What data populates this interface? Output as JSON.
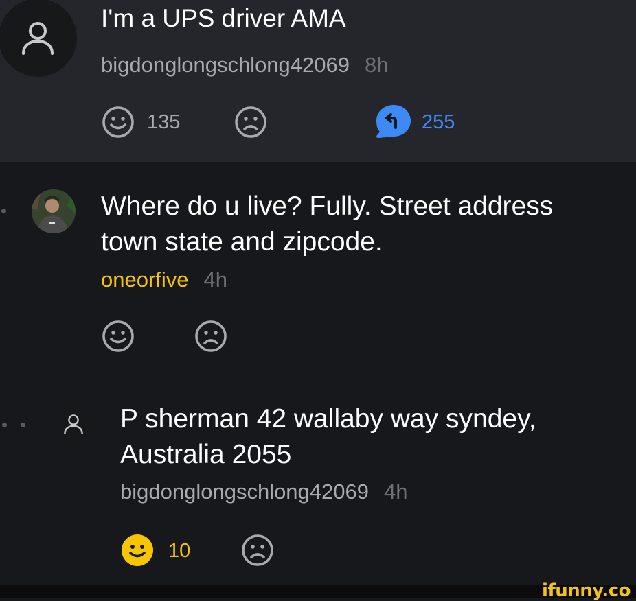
{
  "post": {
    "title": "I'm a UPS driver AMA",
    "author": "bigdonglongschlong42069",
    "time": "8h",
    "smile_count": "135",
    "reply_count": "255"
  },
  "comments": [
    {
      "text_line1": "Where do u live? Fully. Street address",
      "text_line2": "town state and zipcode.",
      "author": "oneorfive",
      "time": "4h"
    },
    {
      "text_line1": "P sherman 42 wallaby way syndey,",
      "text_line2": "Australia 2055",
      "author": "bigdonglongschlong42069",
      "time": "4h",
      "smile_count": "10"
    }
  ],
  "watermark": "ifunny.co",
  "colors": {
    "post_bg": "#25262b",
    "page_bg": "#17181c",
    "accent_blue": "#3d8af7",
    "accent_yellow": "#f7c600",
    "meta_gray": "#a9a9ae"
  }
}
